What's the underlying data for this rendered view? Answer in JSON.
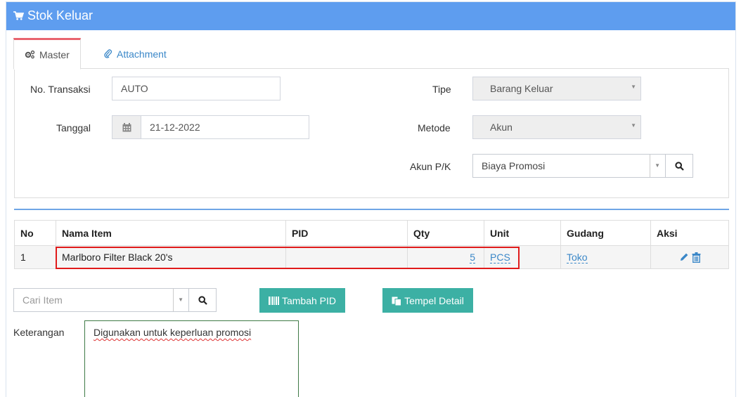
{
  "header": {
    "title": "Stok Keluar",
    "icon": "cart-icon"
  },
  "tabs": [
    {
      "label": "Master",
      "icon": "gears-icon",
      "active": true
    },
    {
      "label": "Attachment",
      "icon": "paperclip-icon",
      "active": false
    }
  ],
  "form": {
    "no_transaksi": {
      "label": "No. Transaksi",
      "value": "AUTO"
    },
    "tanggal": {
      "label": "Tanggal",
      "value": "21-12-2022"
    },
    "tipe": {
      "label": "Tipe",
      "value": "Barang Keluar"
    },
    "metode": {
      "label": "Metode",
      "value": "Akun"
    },
    "akun_pk": {
      "label": "Akun P/K",
      "value": "Biaya Promosi"
    }
  },
  "table": {
    "headers": {
      "no": "No",
      "nama_item": "Nama Item",
      "pid": "PID",
      "qty": "Qty",
      "unit": "Unit",
      "gudang": "Gudang",
      "aksi": "Aksi"
    },
    "rows": [
      {
        "no": "1",
        "nama_item": "Marlboro Filter Black 20's",
        "pid": "",
        "qty": "5",
        "unit": "PCS",
        "gudang": "Toko"
      }
    ]
  },
  "actions": {
    "cari_item_placeholder": "Cari Item",
    "tambah_pid": "Tambah PID",
    "tempel_detail": "Tempel Detail"
  },
  "keterangan": {
    "label": "Keterangan",
    "value": "Digunakan untuk keperluan promosi"
  },
  "colors": {
    "header_bg": "#5e9def",
    "tab_accent": "#e9646e",
    "teal_button": "#3cb0a4",
    "link": "#3a87c8",
    "highlight": "#e01b1b"
  }
}
